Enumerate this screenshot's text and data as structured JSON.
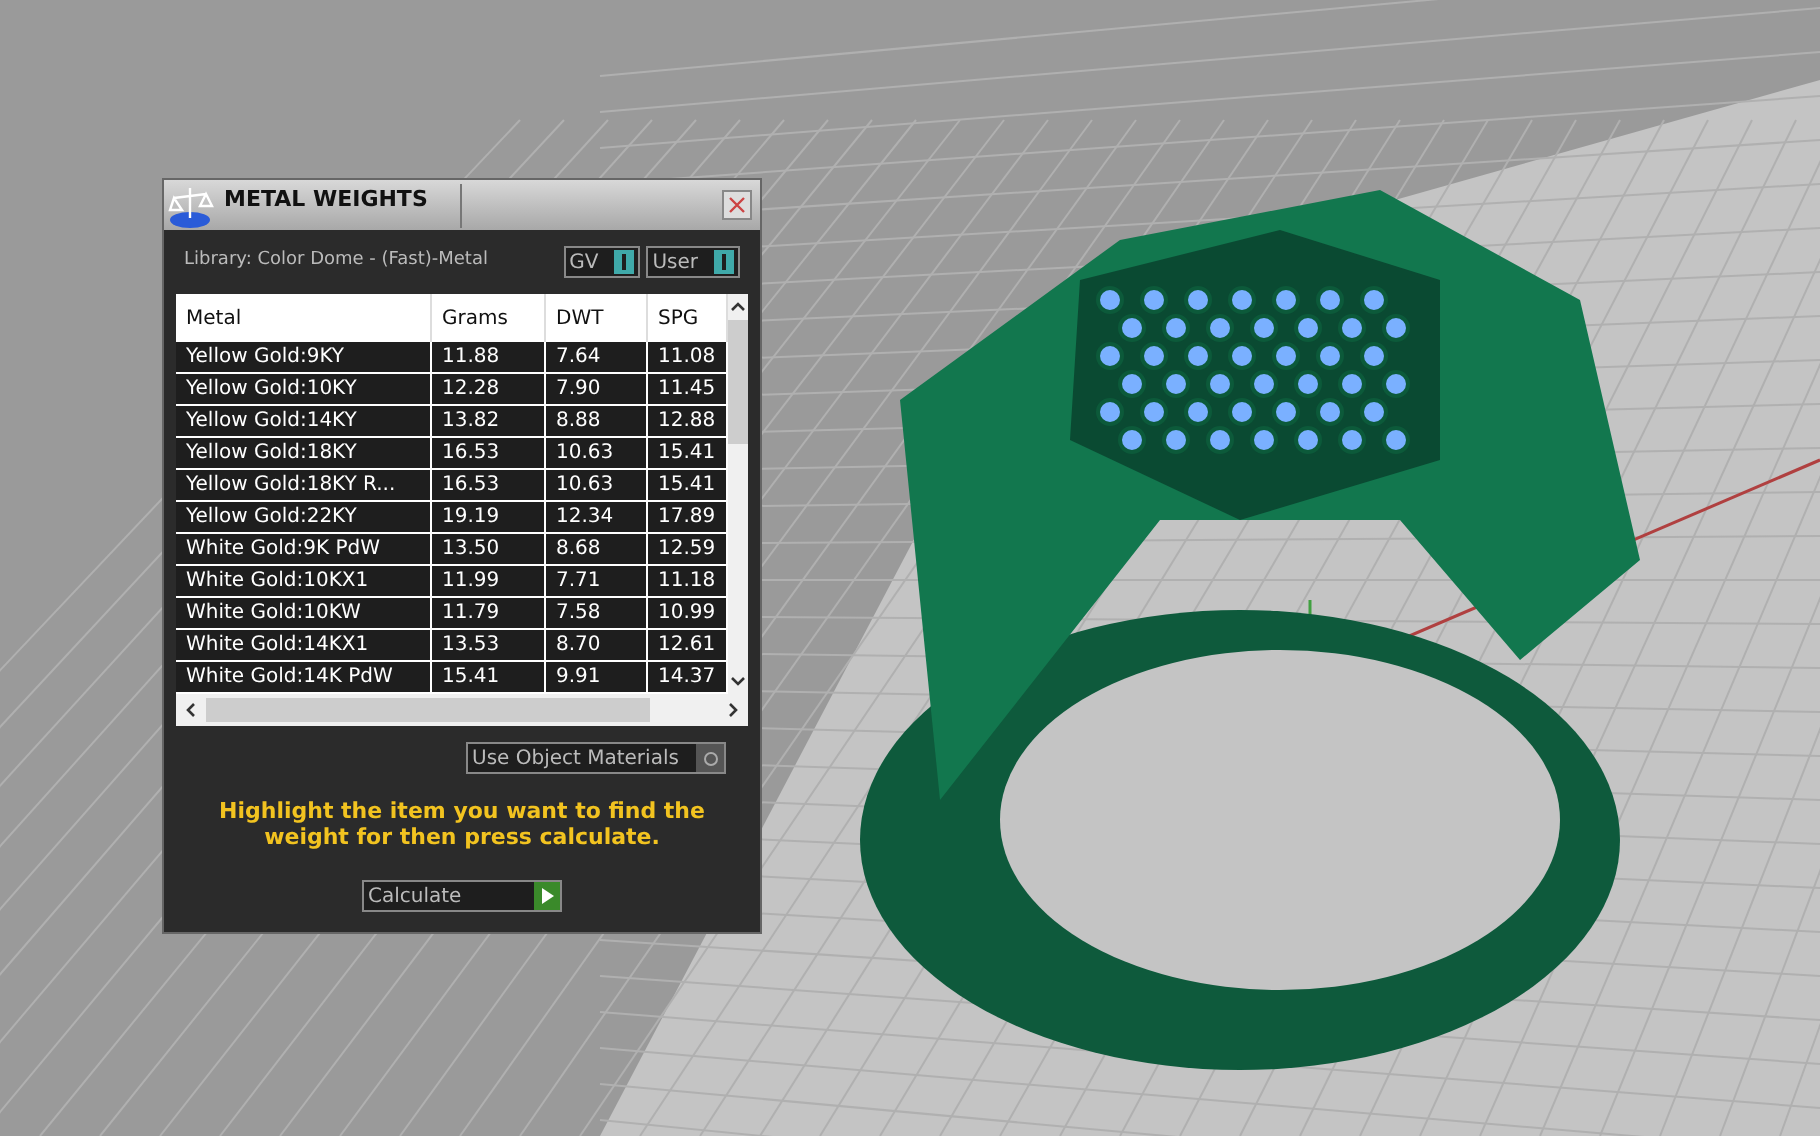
{
  "panel": {
    "title": "METAL WEIGHTS",
    "library": "Library: Color Dome - (Fast)-Metal",
    "toggles": [
      {
        "label": "GV",
        "on": true
      },
      {
        "label": "User",
        "on": true
      }
    ],
    "table": {
      "columns": [
        "Metal",
        "Grams",
        "DWT",
        "SPG"
      ],
      "rows": [
        [
          "Yellow Gold:9KY",
          "11.88",
          "7.64",
          "11.08"
        ],
        [
          "Yellow Gold:10KY",
          "12.28",
          "7.90",
          "11.45"
        ],
        [
          "Yellow Gold:14KY",
          "13.82",
          "8.88",
          "12.88"
        ],
        [
          "Yellow Gold:18KY",
          "16.53",
          "10.63",
          "15.41"
        ],
        [
          "Yellow Gold:18KY R...",
          "16.53",
          "10.63",
          "15.41"
        ],
        [
          "Yellow Gold:22KY",
          "19.19",
          "12.34",
          "17.89"
        ],
        [
          "White Gold:9K PdW",
          "13.50",
          "8.68",
          "12.59"
        ],
        [
          "White Gold:10KX1",
          "11.99",
          "7.71",
          "11.18"
        ],
        [
          "White Gold:10KW",
          "11.79",
          "7.58",
          "10.99"
        ],
        [
          "White Gold:14KX1",
          "13.53",
          "8.70",
          "12.61"
        ],
        [
          "White Gold:14K PdW",
          "15.41",
          "9.91",
          "14.37"
        ]
      ]
    },
    "use_object_materials": {
      "label": "Use Object Materials",
      "on": false
    },
    "hint": "Highlight the item you want to find the weight for then press calculate.",
    "calculate_button": "Calculate"
  }
}
